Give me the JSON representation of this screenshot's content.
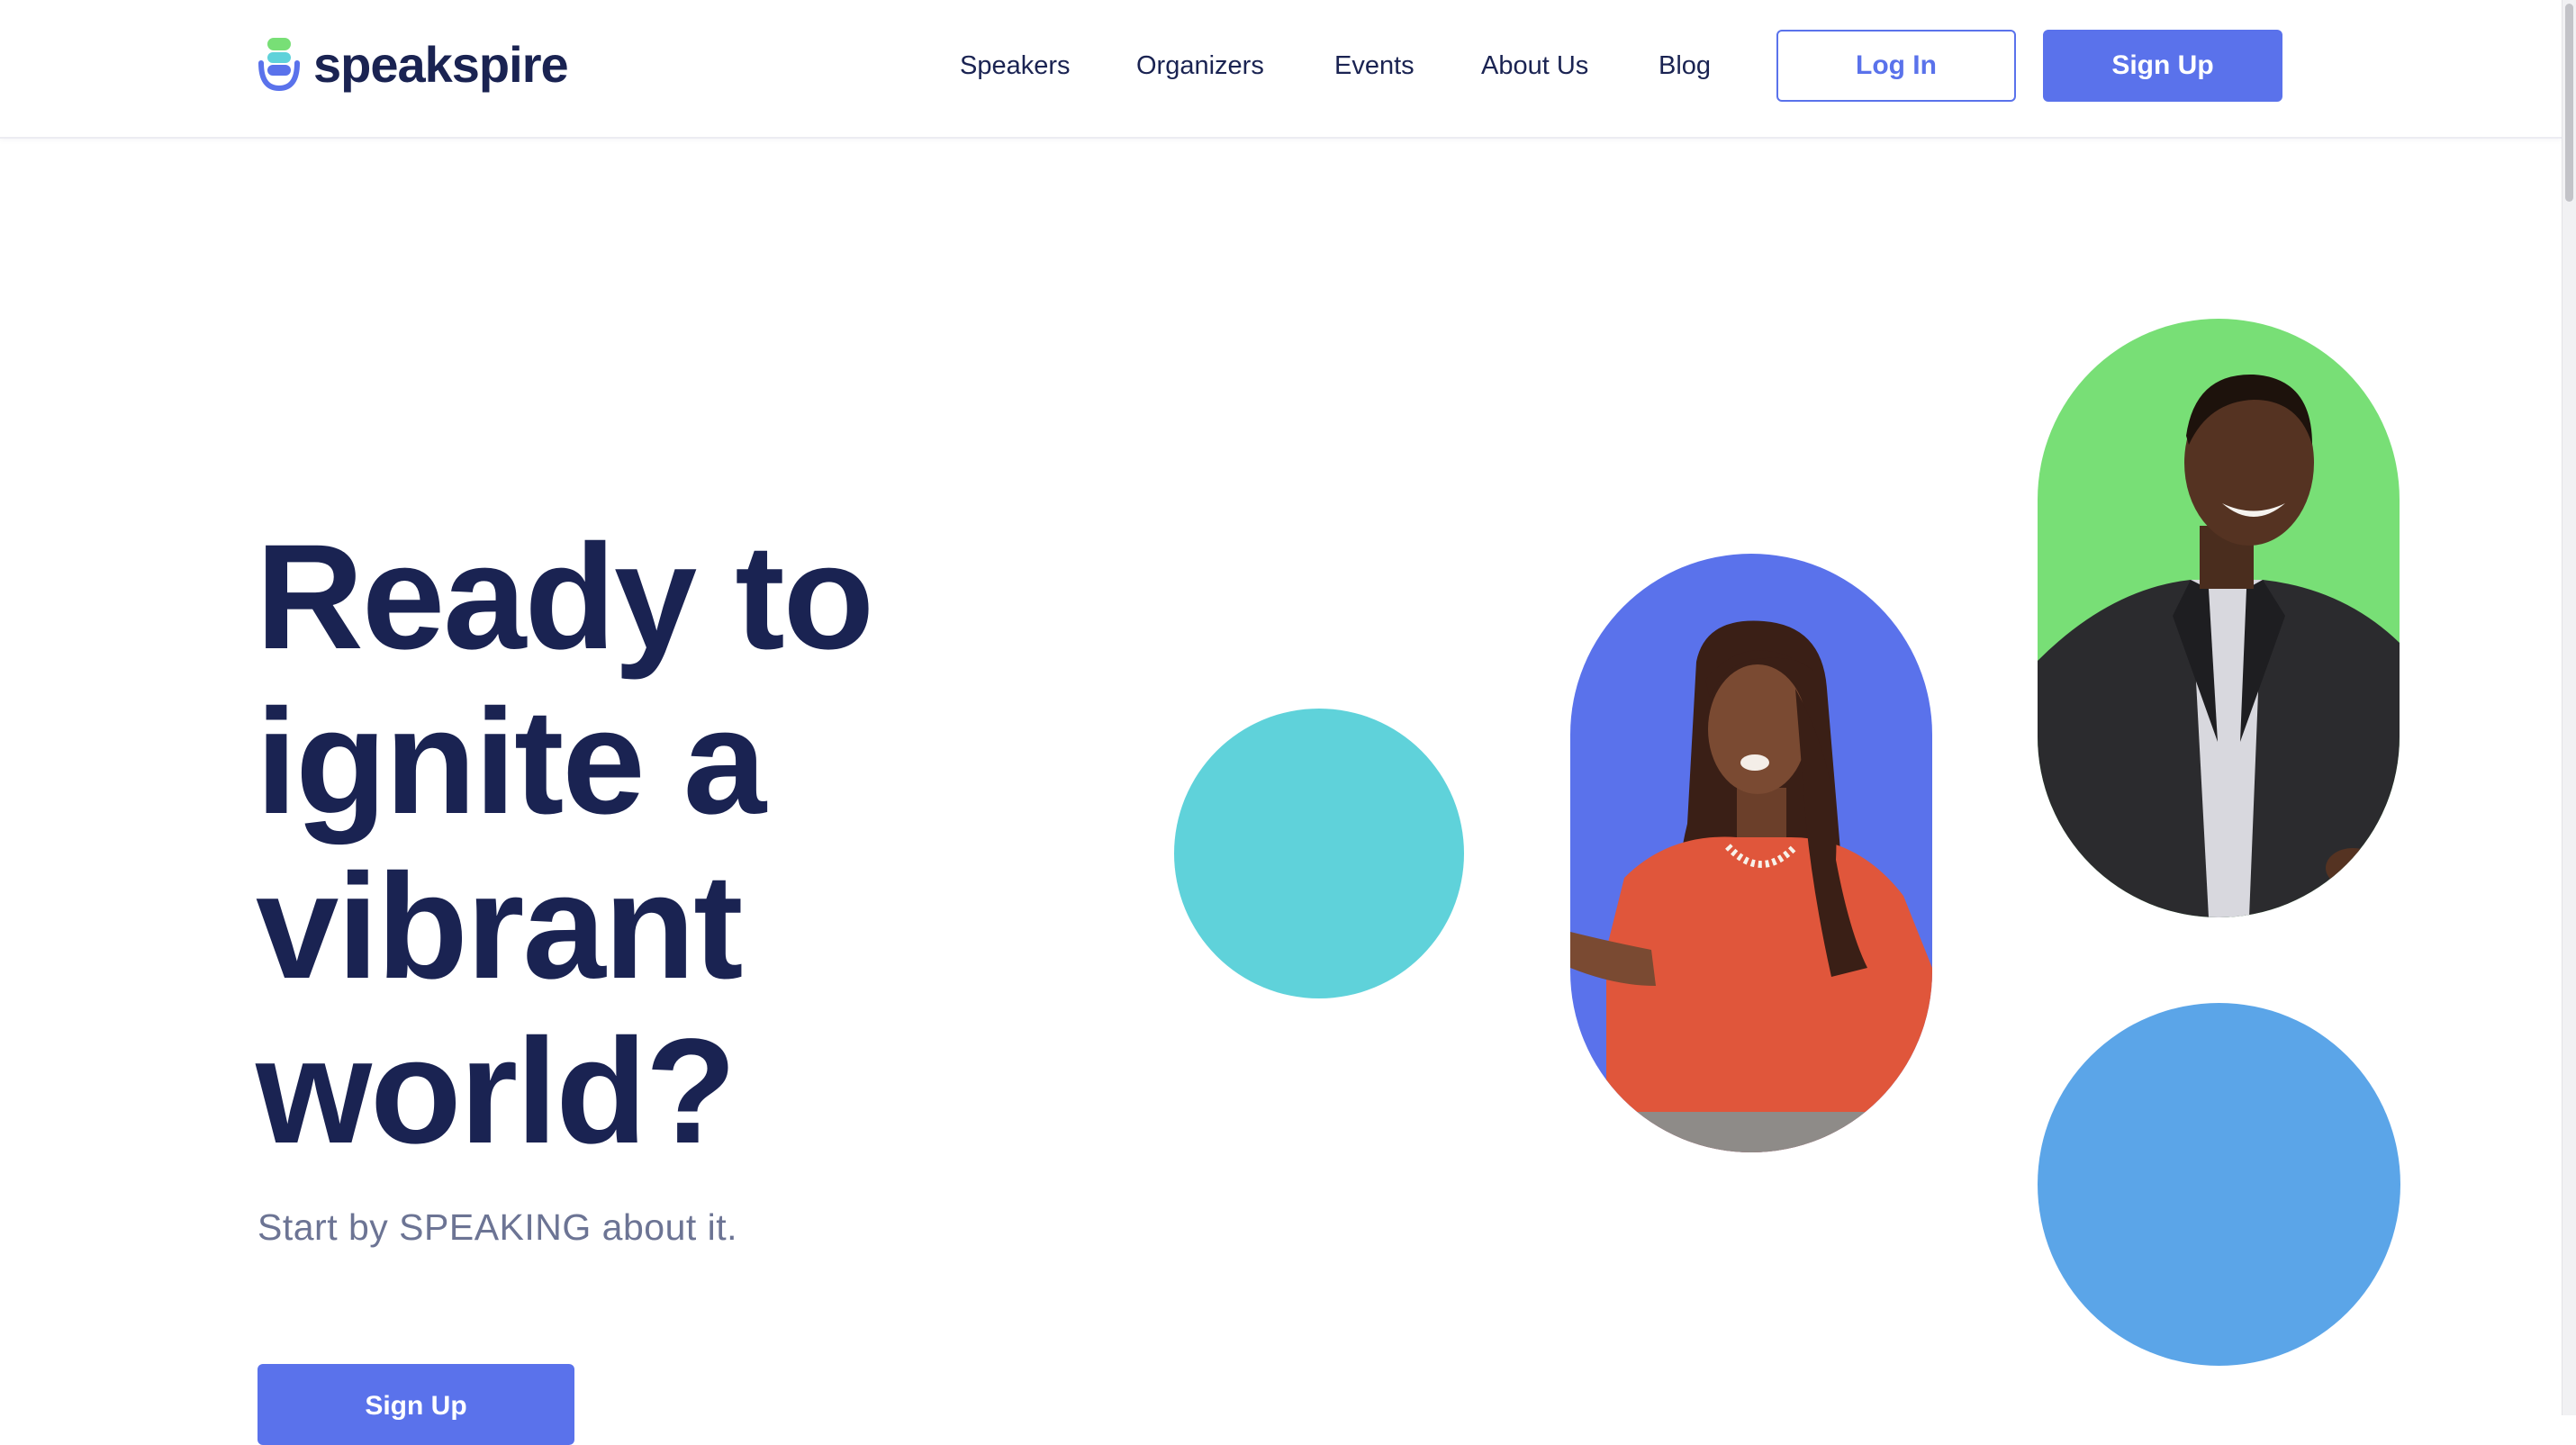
{
  "header": {
    "logo_text": "speakspire",
    "nav": [
      {
        "label": "Speakers"
      },
      {
        "label": "Organizers"
      },
      {
        "label": "Events"
      },
      {
        "label": "About Us"
      },
      {
        "label": "Blog"
      }
    ],
    "login_label": "Log In",
    "signup_label": "Sign Up"
  },
  "hero": {
    "title_lines": [
      "Ready to",
      "ignite a",
      "vibrant",
      "world?"
    ],
    "subtitle": "Start by SPEAKING about it.",
    "cta_label": "Sign Up"
  },
  "colors": {
    "navy": "#1a2352",
    "accent_blue": "#5a72eb",
    "teal": "#5fd2da",
    "green": "#78df76",
    "sky": "#5ba5e8",
    "muted_text": "#6c7494"
  },
  "images": [
    {
      "name": "speaker-woman-photo"
    },
    {
      "name": "speaker-man-photo"
    }
  ]
}
